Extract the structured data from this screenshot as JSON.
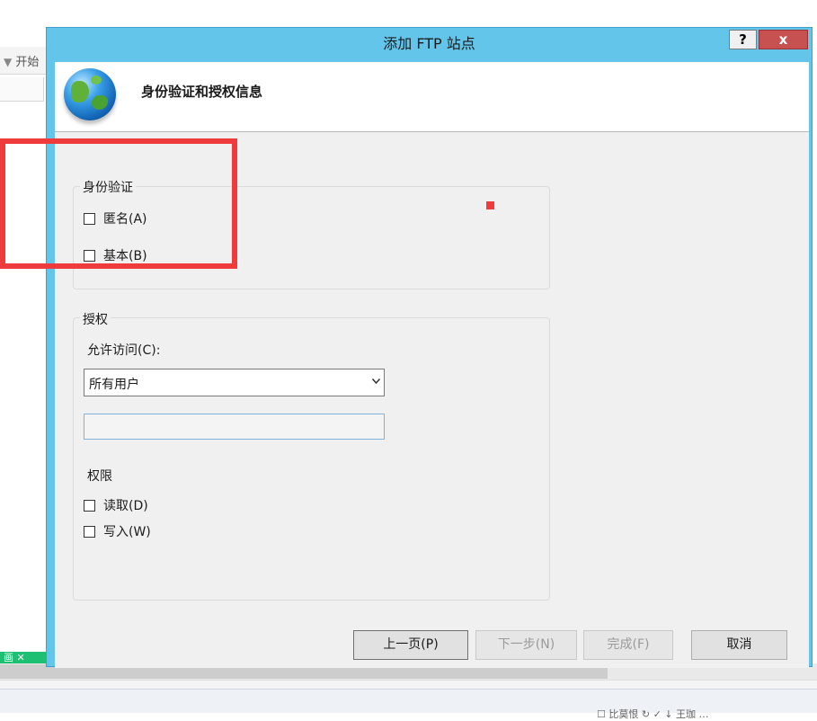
{
  "background": {
    "filter_text": "开始",
    "green_tab_text": "画  ✕",
    "status_text": "☐ 比莫恨   ↻ ✓ ↓ 王珈   …"
  },
  "dialog": {
    "title": "添加 FTP 站点",
    "help_label": "?",
    "close_label": "x",
    "header_title": "身份验证和授权信息",
    "authentication": {
      "group_label": "身份验证",
      "anonymous_label": "匿名(A)",
      "basic_label": "基本(B)"
    },
    "authorization": {
      "group_label": "授权",
      "allow_access_label": "允许访问(C):",
      "allow_access_value": "所有用户",
      "users_textbox_value": "",
      "permissions_label": "权限",
      "read_label": "读取(D)",
      "write_label": "写入(W)"
    },
    "buttons": {
      "previous": "上一页(P)",
      "next": "下一步(N)",
      "finish": "完成(F)",
      "cancel": "取消"
    }
  },
  "colors": {
    "title_bar": "#63c5ea",
    "close_button": "#c75050",
    "highlight": "#ef3b3b"
  }
}
